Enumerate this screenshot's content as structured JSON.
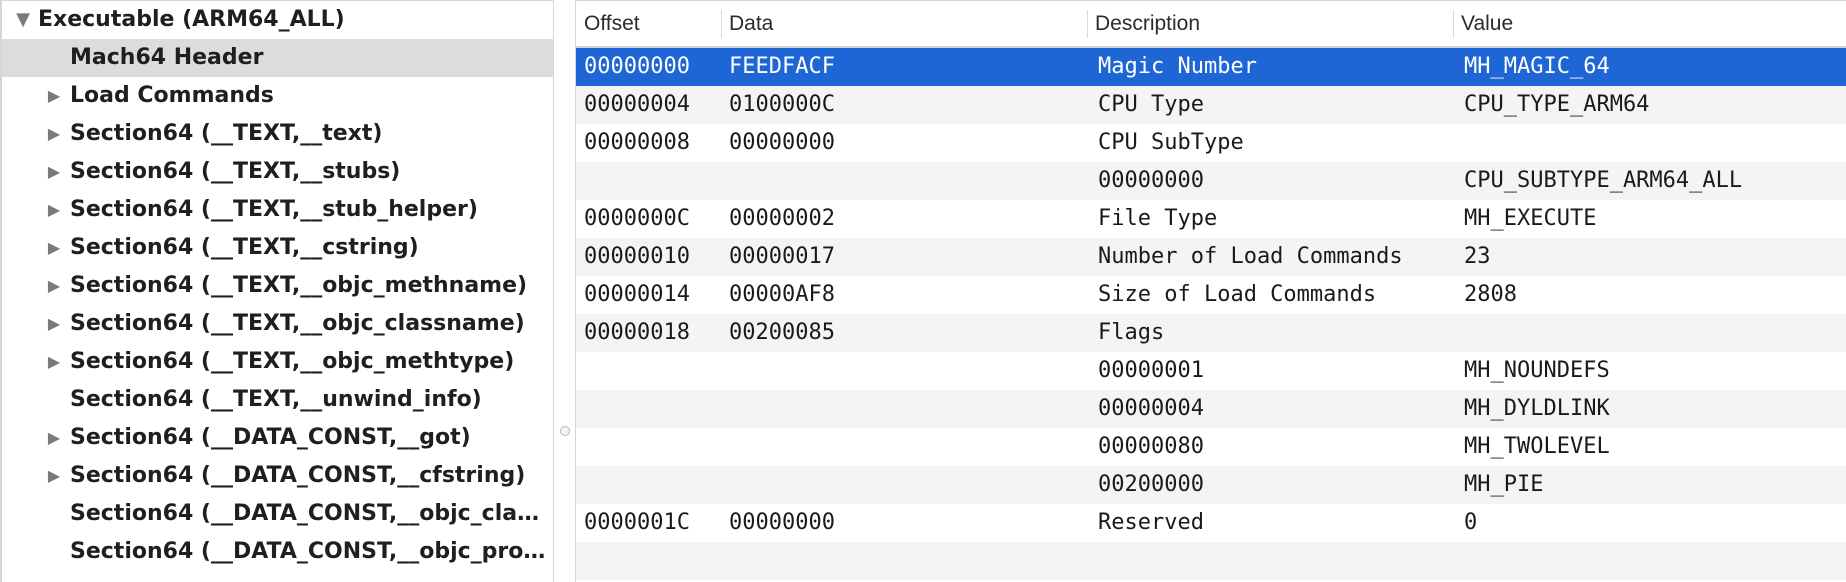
{
  "tree": {
    "items": [
      {
        "label": "Executable  (ARM64_ALL)",
        "level": 0,
        "expander": "expanded",
        "selected": false
      },
      {
        "label": "Mach64 Header",
        "level": 1,
        "expander": "none",
        "selected": true
      },
      {
        "label": "Load Commands",
        "level": 1,
        "expander": "collapsed",
        "selected": false
      },
      {
        "label": "Section64 (__TEXT,__text)",
        "level": 1,
        "expander": "collapsed",
        "selected": false
      },
      {
        "label": "Section64 (__TEXT,__stubs)",
        "level": 1,
        "expander": "collapsed",
        "selected": false
      },
      {
        "label": "Section64 (__TEXT,__stub_helper)",
        "level": 1,
        "expander": "collapsed",
        "selected": false
      },
      {
        "label": "Section64 (__TEXT,__cstring)",
        "level": 1,
        "expander": "collapsed",
        "selected": false
      },
      {
        "label": "Section64 (__TEXT,__objc_methname)",
        "level": 1,
        "expander": "collapsed",
        "selected": false
      },
      {
        "label": "Section64 (__TEXT,__objc_classname)",
        "level": 1,
        "expander": "collapsed",
        "selected": false
      },
      {
        "label": "Section64 (__TEXT,__objc_methtype)",
        "level": 1,
        "expander": "collapsed",
        "selected": false
      },
      {
        "label": "Section64 (__TEXT,__unwind_info)",
        "level": 1,
        "expander": "none",
        "selected": false
      },
      {
        "label": "Section64 (__DATA_CONST,__got)",
        "level": 1,
        "expander": "collapsed",
        "selected": false
      },
      {
        "label": "Section64 (__DATA_CONST,__cfstring)",
        "level": 1,
        "expander": "collapsed",
        "selected": false
      },
      {
        "label": "Section64 (__DATA_CONST,__objc_clas…",
        "level": 1,
        "expander": "none",
        "selected": false
      },
      {
        "label": "Section64 (__DATA_CONST,__objc_prot…",
        "level": 1,
        "expander": "none",
        "selected": false
      }
    ]
  },
  "table": {
    "headers": {
      "offset": "Offset",
      "data": "Data",
      "description": "Description",
      "value": "Value"
    },
    "rows": [
      {
        "offset": "00000000",
        "data": "FEEDFACF",
        "description": "Magic Number",
        "value": "MH_MAGIC_64",
        "selected": true
      },
      {
        "offset": "00000004",
        "data": "0100000C",
        "description": "CPU Type",
        "value": "CPU_TYPE_ARM64",
        "selected": false
      },
      {
        "offset": "00000008",
        "data": "00000000",
        "description": "CPU SubType",
        "value": "",
        "selected": false
      },
      {
        "offset": "",
        "data": "",
        "description": "00000000",
        "value": "CPU_SUBTYPE_ARM64_ALL",
        "selected": false
      },
      {
        "offset": "0000000C",
        "data": "00000002",
        "description": "File Type",
        "value": "MH_EXECUTE",
        "selected": false
      },
      {
        "offset": "00000010",
        "data": "00000017",
        "description": "Number of Load Commands",
        "value": "23",
        "selected": false
      },
      {
        "offset": "00000014",
        "data": "00000AF8",
        "description": "Size of Load Commands",
        "value": "2808",
        "selected": false
      },
      {
        "offset": "00000018",
        "data": "00200085",
        "description": "Flags",
        "value": "",
        "selected": false
      },
      {
        "offset": "",
        "data": "",
        "description": "00000001",
        "value": "MH_NOUNDEFS",
        "selected": false
      },
      {
        "offset": "",
        "data": "",
        "description": "00000004",
        "value": "MH_DYLDLINK",
        "selected": false
      },
      {
        "offset": "",
        "data": "",
        "description": "00000080",
        "value": "MH_TWOLEVEL",
        "selected": false
      },
      {
        "offset": "",
        "data": "",
        "description": "00200000",
        "value": "MH_PIE",
        "selected": false
      },
      {
        "offset": "0000001C",
        "data": "00000000",
        "description": "Reserved",
        "value": "0",
        "selected": false
      },
      {
        "offset": "",
        "data": "",
        "description": "",
        "value": "",
        "selected": false
      }
    ]
  },
  "colors": {
    "selection_blue": "#1e66d6",
    "tree_selection_gray": "#dcdcdc",
    "stripe": "#f4f4f4"
  }
}
